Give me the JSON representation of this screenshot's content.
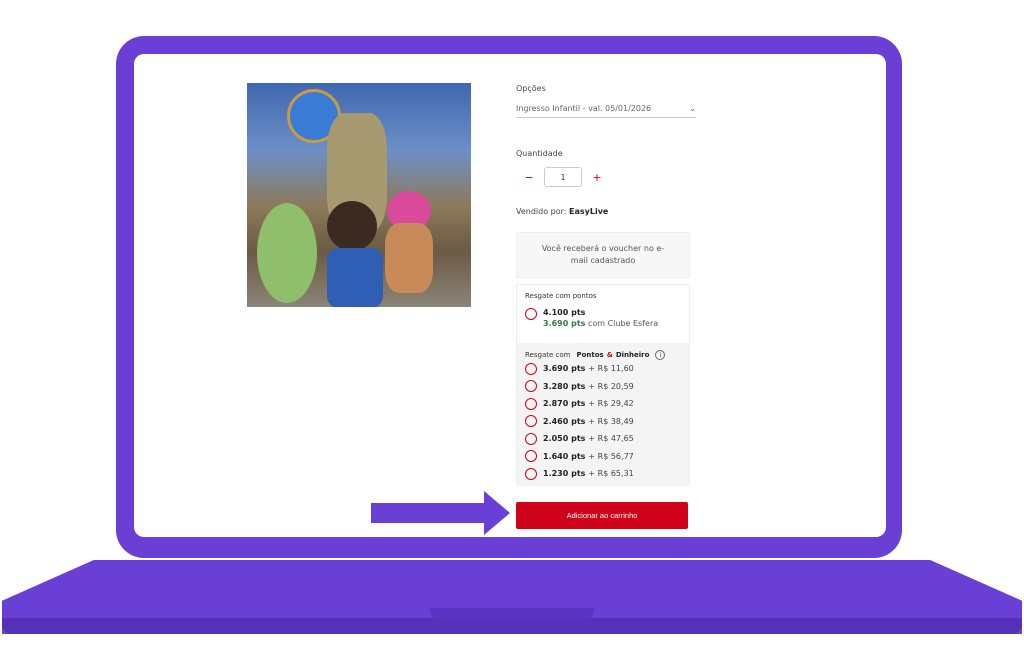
{
  "options": {
    "label": "Opções",
    "selected": "Ingresso Infantil - val. 05/01/2026"
  },
  "quantity": {
    "label": "Quantidade",
    "value": "1",
    "minus": "−",
    "plus": "+"
  },
  "seller": {
    "prefix": "Vendido por:",
    "name": "EasyLive"
  },
  "voucher_notice": "Você receberá o voucher no e-mail cadastrado",
  "points": {
    "title": "Resgate com pontos",
    "main": "4.100 pts",
    "club_pts": "3.690 pts",
    "club_suffix": "com Clube Esfera"
  },
  "mix": {
    "title_prefix": "Resgate com",
    "title_pontos": "Pontos",
    "title_amp": "&",
    "title_dinheiro": "Dinheiro",
    "options": [
      {
        "pts": "3.690 pts",
        "money": "+ R$ 11,60"
      },
      {
        "pts": "3.280 pts",
        "money": "+ R$ 20,59"
      },
      {
        "pts": "2.870 pts",
        "money": "+ R$ 29,42"
      },
      {
        "pts": "2.460 pts",
        "money": "+ R$ 38,49"
      },
      {
        "pts": "2.050 pts",
        "money": "+ R$ 47,65"
      },
      {
        "pts": "1.640 pts",
        "money": "+ R$ 56,77"
      },
      {
        "pts": "1.230 pts",
        "money": "+ R$ 65,31"
      }
    ]
  },
  "cart_button": "Adicionar ao carrinho",
  "colors": {
    "frame": "#6a3fd6",
    "accent": "#d0021b",
    "club_green": "#2f7a4b"
  }
}
